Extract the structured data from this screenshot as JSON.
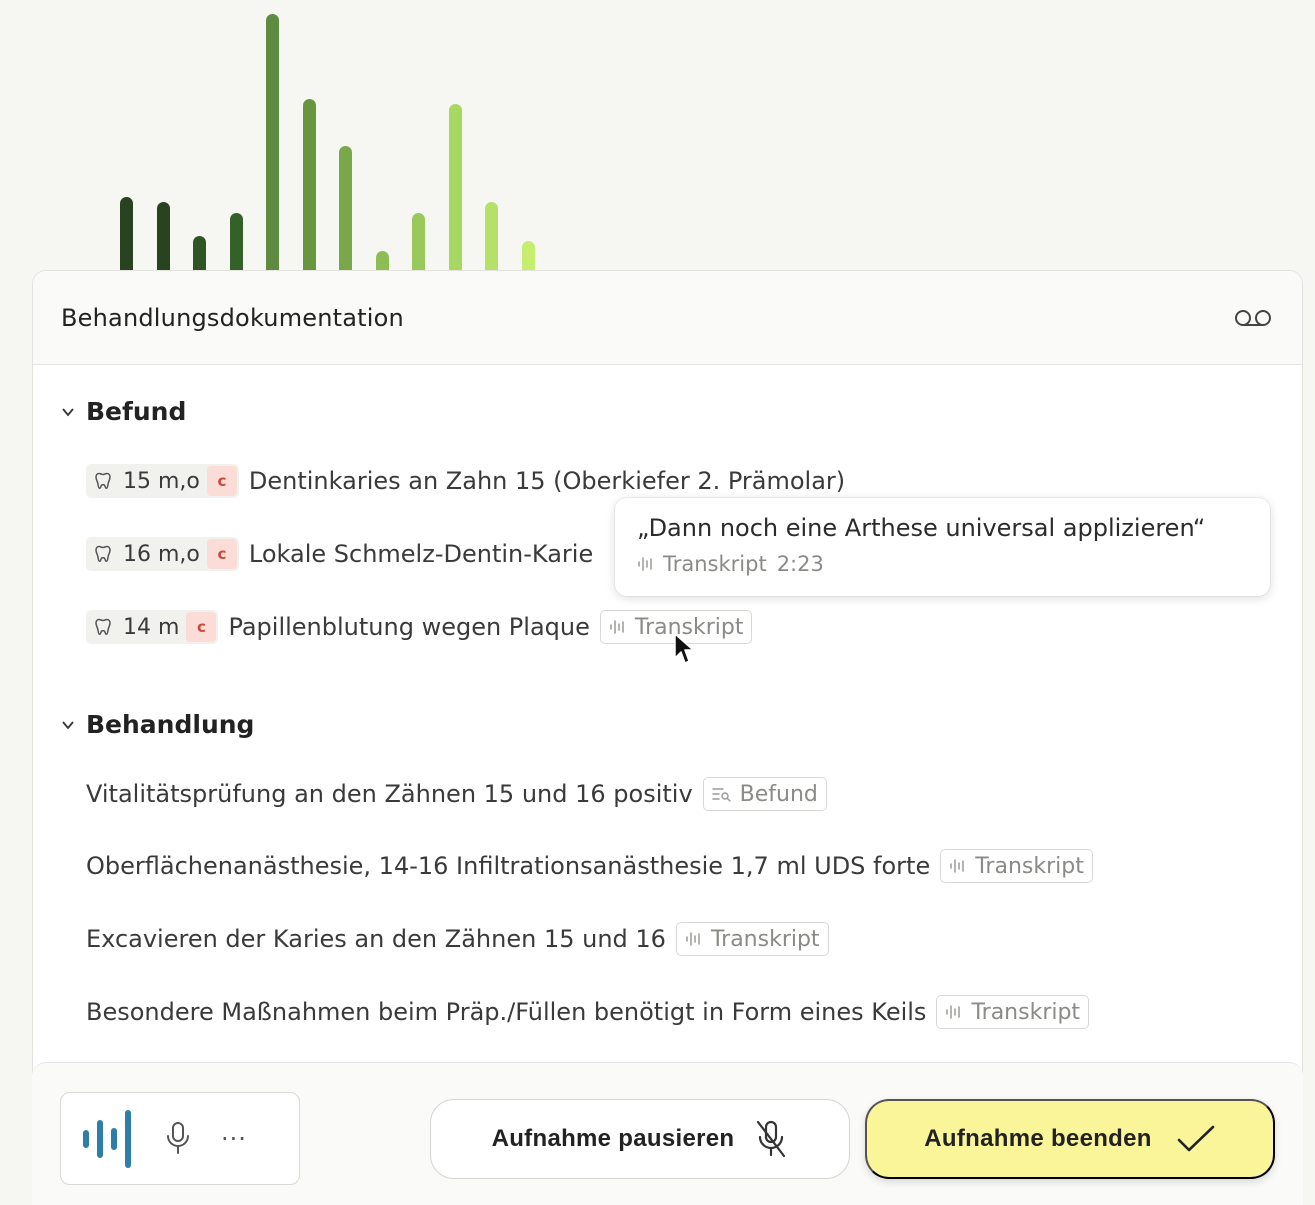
{
  "visualizer": {
    "levels": [
      0.29,
      0.27,
      0.14,
      0.23,
      1.0,
      0.67,
      0.49,
      0.08,
      0.23,
      0.65,
      0.27,
      0.12
    ],
    "colors": [
      "#27431f",
      "#27431f",
      "#2f5525",
      "#34602a",
      "#5e8b3f",
      "#67963f",
      "#78a84a",
      "#8cbe55",
      "#99c95a",
      "#a7d862",
      "#b4e168",
      "#c5ee6f"
    ]
  },
  "card": {
    "title": "Behandlungsdokumentation"
  },
  "befund": {
    "heading": "Befund",
    "items": [
      {
        "tooth": "15",
        "surface": "m,o",
        "badge": "c",
        "text": "Dentinkaries an Zahn 15 (Oberkiefer 2. Prämolar)"
      },
      {
        "tooth": "16",
        "surface": "m,o",
        "badge": "c",
        "text": "Lokale Schmelz-Dentin-Karie"
      },
      {
        "tooth": "14",
        "surface": "m",
        "badge": "c",
        "text": "Papillenblutung wegen Plaque",
        "tag": "Transkript"
      }
    ]
  },
  "tooltip": {
    "quote": "„Dann noch eine Arthese universal applizieren“",
    "source": "Transkript",
    "time": "2:23"
  },
  "behandlung": {
    "heading": "Behandlung",
    "items": [
      {
        "text": "Vitalitätsprüfung an den Zähnen 15 und 16 positiv",
        "tag": "Befund",
        "tag_icon": "findings-icon"
      },
      {
        "text": "Oberflächenanästhesie, 14-16 Infiltrationsanästhesie 1,7 ml UDS forte",
        "tag": "Transkript",
        "tag_icon": "waveform-icon"
      },
      {
        "text": "Excavieren der Karies an den Zähnen 15 und 16",
        "tag": "Transkript",
        "tag_icon": "waveform-icon"
      },
      {
        "text": "Besondere Maßnahmen beim Präp./Füllen benötigt in Form eines Keils",
        "tag": "Transkript",
        "tag_icon": "waveform-icon"
      }
    ]
  },
  "footer": {
    "more_label": "···",
    "pause_label": "Aufnahme pausieren",
    "end_label": "Aufnahme beenden"
  },
  "colors": {
    "end_button": "#fbf59a",
    "badge_bg": "#fbdcd6",
    "badge_text": "#c94a3a",
    "accent_blue": "#2f7eaa"
  }
}
